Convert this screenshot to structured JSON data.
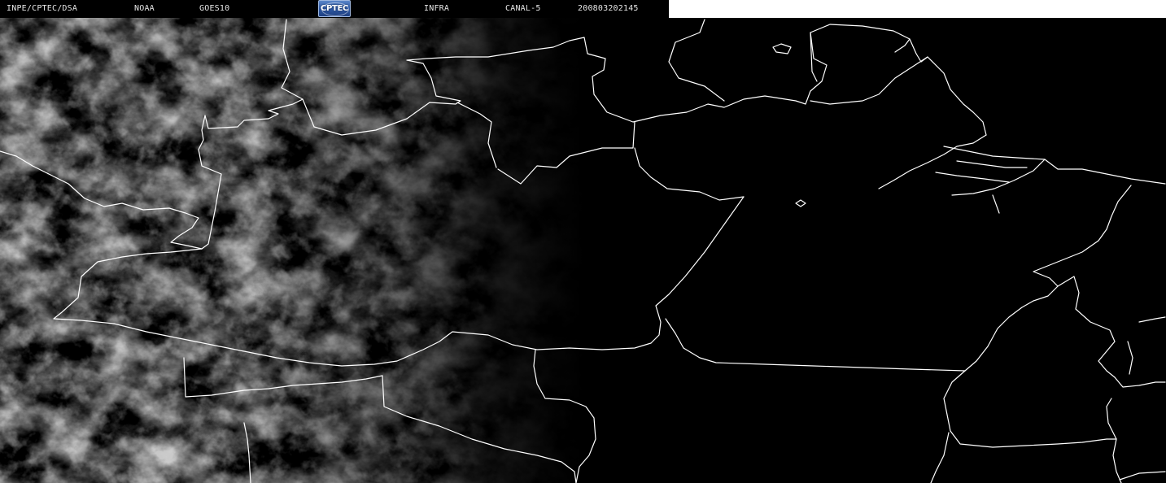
{
  "header": {
    "institution": "INPE/CPTEC/DSA",
    "agency": "NOAA",
    "satellite": "GOES10",
    "logo_text": "CPTEC",
    "band": "INFRA",
    "channel": "CANAL-5",
    "timestamp": "200803202145"
  },
  "colors": {
    "header_background": "#000000",
    "header_blank": "#ffffff",
    "border_lines": "#ffffff",
    "cloud_tint": "#8a8a8a",
    "logo_blue": "#2f5aa6"
  },
  "icons": {
    "logo": "cptec-logo-icon"
  }
}
